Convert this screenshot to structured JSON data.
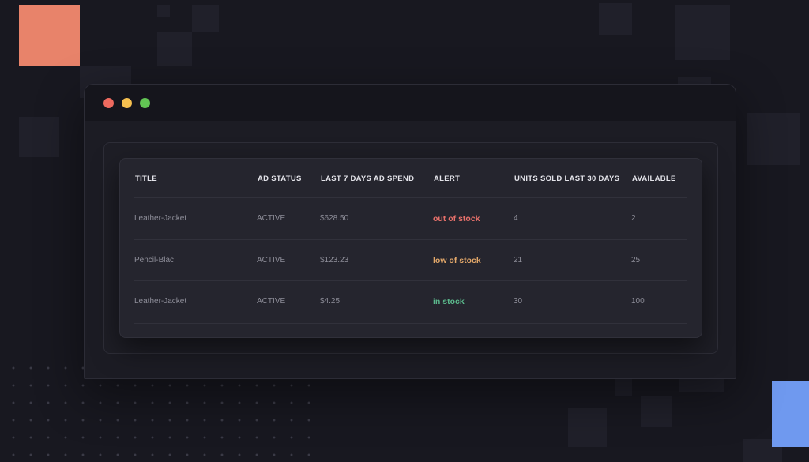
{
  "colors": {
    "background": "#181820",
    "accent_orange": "#e8836a",
    "accent_blue": "#6f99ef",
    "alert_out": "#e8716b",
    "alert_low": "#e3a86a",
    "alert_in": "#5bb98c"
  },
  "window": {
    "controls": [
      "close-icon",
      "minimize-icon",
      "maximize-icon"
    ]
  },
  "table": {
    "headers": {
      "title": "TITLE",
      "ad_status": "AD STATUS",
      "spend": "LAST 7 DAYS AD SPEND",
      "alert": "ALERT",
      "units": "UNITS SOLD LAST 30 DAYS",
      "available": "AVAILABLE"
    },
    "rows": [
      {
        "title": "Leather-Jacket",
        "ad_status": "ACTIVE",
        "spend": "$628.50",
        "alert": "out of stock",
        "alert_color": "#e8716b",
        "units": "4",
        "available": "2"
      },
      {
        "title": "Pencil-Blac",
        "ad_status": "ACTIVE",
        "spend": "$123.23",
        "alert": "low of stock",
        "alert_color": "#e3a86a",
        "units": "21",
        "available": "25"
      },
      {
        "title": "Leather-Jacket",
        "ad_status": "ACTIVE",
        "spend": "$4.25",
        "alert": "in stock",
        "alert_color": "#5bb98c",
        "units": "30",
        "available": "100"
      }
    ]
  }
}
